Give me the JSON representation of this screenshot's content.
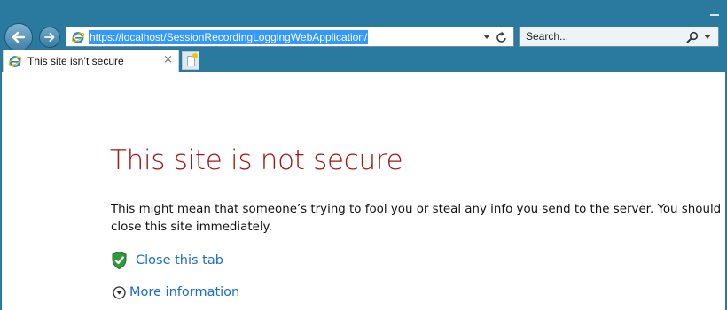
{
  "browser": {
    "address": "https://localhost/SessionRecordingLoggingWebApplication/",
    "search_placeholder": "Search...",
    "tab_title": "This site isn’t secure",
    "tab_close": "×"
  },
  "page": {
    "heading": "This site is not secure",
    "description": "This might mean that someone’s trying to fool you or steal any info you send to the server. You should close this site immediately.",
    "close_tab_label": "Close this tab",
    "more_info_label": "More information"
  },
  "colors": {
    "chrome": "#2a7aa0",
    "heading": "#a31515",
    "link": "#1a6ec4",
    "selection": "#3399ff"
  },
  "icons": {
    "back": "back-arrow-icon",
    "forward": "forward-arrow-icon",
    "ie": "internet-explorer-icon",
    "refresh": "refresh-icon",
    "search": "search-icon",
    "shield": "shield-check-icon",
    "expand": "chevron-down-circle-icon"
  }
}
